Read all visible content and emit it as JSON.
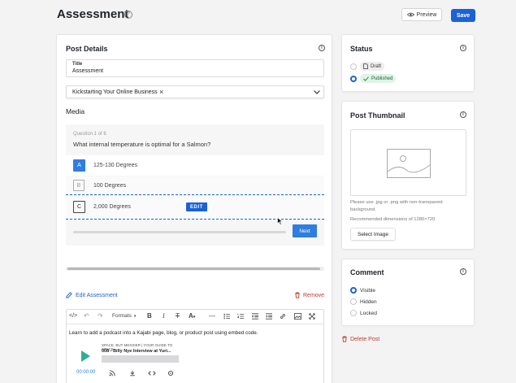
{
  "page": {
    "title": "Assessment",
    "preview_label": "Preview",
    "save_label": "Save"
  },
  "post_details": {
    "heading": "Post Details",
    "title_label": "Title",
    "title_value": "Assessment",
    "selected_offer": "Kickstarting Your Online Business",
    "media_heading": "Media"
  },
  "quiz": {
    "counter": "Question 1 of 6",
    "question": "What internal temperature is optimal for a Salmon?",
    "answers": [
      {
        "letter": "A",
        "text": "125-130 Degrees"
      },
      {
        "letter": "B",
        "text": "100 Degrees"
      },
      {
        "letter": "C",
        "text": "2,000 Degrees"
      }
    ],
    "edit_label": "EDIT",
    "next_label": "Next"
  },
  "actions": {
    "edit_assessment": "Edit Assessment",
    "remove": "Remove"
  },
  "editor": {
    "formats_label": "Formats",
    "body_text": "Learn to add a podcast into a Kajabi page, blog, or product post using embed code.",
    "podcast": {
      "show": "SPACE, BUT MESSIER | YOUR GUIDE TO SPACE",
      "episode": "008 - Billy Nye Interview at Yuri...",
      "time": "00:00:00"
    }
  },
  "status": {
    "heading": "Status",
    "options": [
      {
        "label": "Draft",
        "selected": false
      },
      {
        "label": "Published",
        "selected": true
      }
    ]
  },
  "thumbnail": {
    "heading": "Post Thumbnail",
    "hint": "Please use .jpg or .png with non-transparent background.",
    "dimensions": "Recommended dimensions of 1280×720",
    "select_label": "Select Image"
  },
  "comment": {
    "heading": "Comment",
    "options": [
      {
        "label": "Visible",
        "selected": true
      },
      {
        "label": "Hidden",
        "selected": false
      },
      {
        "label": "Locked",
        "selected": false
      }
    ]
  },
  "delete_label": "Delete Post",
  "colors": {
    "primary": "#1a62d6",
    "danger": "#c0392b",
    "published_bg": "#dff3e6"
  }
}
